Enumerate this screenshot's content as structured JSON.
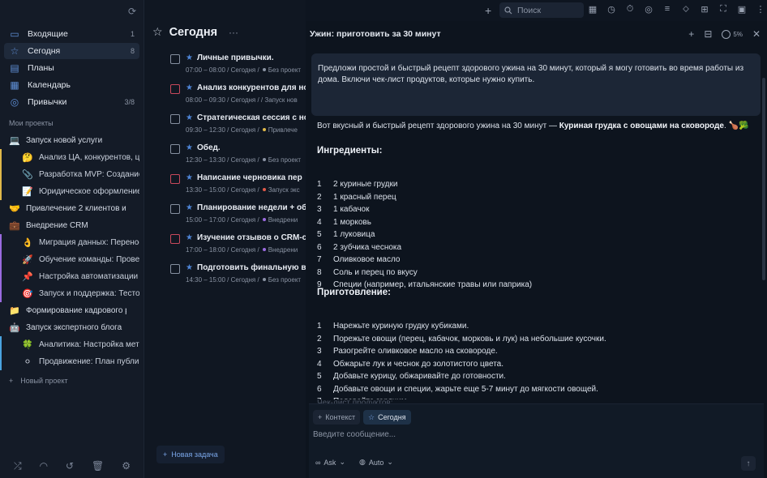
{
  "sidebar": {
    "nav": [
      {
        "label": "Входящие",
        "count": "1",
        "icon": "inbox-icon"
      },
      {
        "label": "Сегодня",
        "count": "8",
        "icon": "star-icon"
      },
      {
        "label": "Планы",
        "count": "",
        "icon": "calendar-list-icon"
      },
      {
        "label": "Календарь",
        "count": "",
        "icon": "calendar-icon"
      },
      {
        "label": "Привычки",
        "count": "3/8",
        "icon": "habit-icon"
      }
    ],
    "section_title": "Мои проекты",
    "projects": [
      {
        "emoji": "💻",
        "label": "Запуск новой услуги",
        "sub": false,
        "bar": ""
      },
      {
        "emoji": "🤔",
        "label": "Анализ ЦА, конкурентов, це",
        "sub": true,
        "bar": "#e0b84a"
      },
      {
        "emoji": "📎",
        "label": "Разработка MVP: Создание",
        "sub": true,
        "bar": "#e0b84a"
      },
      {
        "emoji": "📝",
        "label": "Юридическое оформление",
        "sub": true,
        "bar": "#e0b84a"
      },
      {
        "emoji": "🤝",
        "label": "Привлечение 2 клиентов из",
        "sub": false,
        "bar": ""
      },
      {
        "emoji": "💼",
        "label": "Внедрение CRM",
        "sub": false,
        "bar": ""
      },
      {
        "emoji": "👌",
        "label": "Миграция данных: Перенос",
        "sub": true,
        "bar": "#9a6be0"
      },
      {
        "emoji": "🚀",
        "label": "Обучение команды: Провед",
        "sub": true,
        "bar": "#9a6be0"
      },
      {
        "emoji": "📌",
        "label": "Настройка автоматизации",
        "sub": true,
        "bar": "#9a6be0"
      },
      {
        "emoji": "🎯",
        "label": "Запуск и поддержка: Тестов",
        "sub": true,
        "bar": "#9a6be0"
      },
      {
        "emoji": "📁",
        "label": "Формирование кадрового р",
        "sub": false,
        "bar": ""
      },
      {
        "emoji": "🤖",
        "label": "Запуск экспертного блога",
        "sub": false,
        "bar": ""
      },
      {
        "emoji": "🍀",
        "label": "Аналитика: Настройка метр",
        "sub": true,
        "bar": "#4aa3e0"
      },
      {
        "emoji": "⚪",
        "label": "Продвижение: План публик",
        "sub": true,
        "bar": "#4aa3e0"
      }
    ],
    "new_project": "Новый проект"
  },
  "tasks": {
    "title": "Сегодня",
    "items": [
      {
        "name": "Личные привычки.",
        "time": "07:00 – 08:00 / Сегодня",
        "project": "Без проект",
        "dot": "#8a93a3",
        "red": false
      },
      {
        "name": "Анализ конкурентов для нов",
        "time": "08:00 – 09:30 / Сегодня",
        "project": "Запуск нов",
        "dot": "",
        "red": true
      },
      {
        "name": "Стратегическая сессия с нов",
        "time": "09:30 – 12:30 / Сегодня",
        "project": "Привлече",
        "dot": "#e0b84a",
        "red": false
      },
      {
        "name": "Обед.",
        "time": "12:30 – 13:30 / Сегодня",
        "project": "Без проект",
        "dot": "#8a93a3",
        "red": false
      },
      {
        "name": "Написание черновика пер",
        "time": "13:30 – 15:00 / Сегодня",
        "project": "Запуск экс",
        "dot": "#e05a4a",
        "red": true
      },
      {
        "name": "Планирование недели + об",
        "time": "15:00 – 17:00 / Сегодня",
        "project": "Внедрени",
        "dot": "#9a6be0",
        "red": false
      },
      {
        "name": "Изучение отзывов о CRM-сис",
        "time": "17:00 – 18:00 / Сегодня",
        "project": "Внедрени",
        "dot": "#9a6be0",
        "red": true
      },
      {
        "name": "Подготовить финальную верс",
        "time": "14:30 – 15:00 / Сегодня",
        "project": "Без проект",
        "dot": "#8a93a3",
        "red": false
      }
    ],
    "new_task": "Новая задача"
  },
  "topbar": {
    "search_placeholder": "Поиск"
  },
  "chat": {
    "title": "Ужин: приготовить за 30 минут",
    "progress_label": "5%",
    "user_message": "Предложи простой и быстрый рецепт здорового ужина на 30 минут, который я могу готовить во время работы из дома. Включи чек-лист продуктов, которые нужно купить.",
    "intro_prefix": "Вот вкусный и быстрый рецепт здорового ужина на 30 минут — ",
    "intro_bold": "Куриная грудка с овощами на сковороде",
    "intro_suffix": ". 🍗🥦",
    "ingredients_title": "Ингредиенты:",
    "ingredients": [
      "2 куриные грудки",
      "1 красный перец",
      "1 кабачок",
      "1 морковь",
      "1 луковица",
      "2 зубчика чеснока",
      "Оливковое масло",
      "Соль и перец по вкусу",
      "Специи (например, итальянские травы или паприка)"
    ],
    "steps_title": "Приготовление:",
    "steps": [
      "Нарежьте куриную грудку кубиками.",
      "Порежьте овощи (перец, кабачок, морковь и лук) на небольшие кусочки.",
      "Разогрейте оливковое масло на сковороде.",
      "Обжарьте лук и чеснок до золотистого цвета.",
      "Добавьте курицу, обжаривайте до готовности.",
      "Добавьте овощи и специи, жарьте еще 5-7 минут до мягкости овощей.",
      "Подавайте горячим."
    ],
    "faded_line": "Чек-лист продуктов:",
    "context_chip": "Контекст",
    "today_chip": "Сегодня",
    "input_placeholder": "Введите сообщение...",
    "mode_label": "Ask",
    "model_label": "Auto"
  }
}
